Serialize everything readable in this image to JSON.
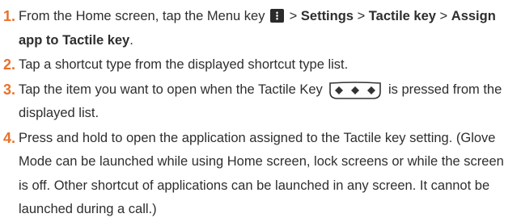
{
  "steps": [
    {
      "num": "1.",
      "t1": "From the Home screen, tap the Menu key",
      "t2": " > ",
      "settings": "Settings",
      "t3": " > ",
      "tactile": "Tactile key",
      "t4": " > ",
      "assign": "Assign app to Tactile key",
      "t5": "."
    },
    {
      "num": "2.",
      "text": "Tap a shortcut type from the displayed shortcut type list."
    },
    {
      "num": "3.",
      "t1": "Tap the item you want to open when the Tactile Key",
      "t2": "is pressed from the displayed list."
    },
    {
      "num": "4.",
      "text": "Press and hold to open the application assigned to the Tactile key setting. (Glove Mode can be launched while using Home screen, lock screens or while the screen is off. Other shortcut of applications can be launched in any screen. It cannot be launched during a call.)"
    }
  ],
  "colors": {
    "step_number": "#e8712c",
    "text": "#2e2e2e",
    "menu_key": "#2b2b2b"
  },
  "icons": [
    "menu-key-icon",
    "tactile-key-icon"
  ]
}
